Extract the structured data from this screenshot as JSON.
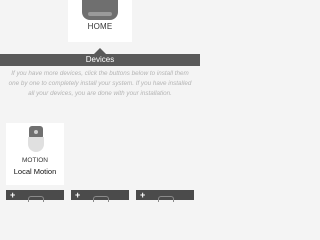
{
  "home": {
    "label": "HOME"
  },
  "section": {
    "title": "Devices"
  },
  "instructions": "If you have more devices, click the buttons below to install them one by one to completely install your system. If you have installed all your devices, you are done with your installation.",
  "installed_devices": [
    {
      "type": "MOTION",
      "name": "Local Motion"
    }
  ],
  "add_buttons": [
    {
      "symbol": "+"
    },
    {
      "symbol": "+"
    },
    {
      "symbol": "+"
    }
  ],
  "colors": {
    "page_background": "#f4f4f4",
    "section_bar": "#595959",
    "instruction_text": "#b4b4b4",
    "card": "#ffffff",
    "add_tile": "#4b4b4b"
  }
}
